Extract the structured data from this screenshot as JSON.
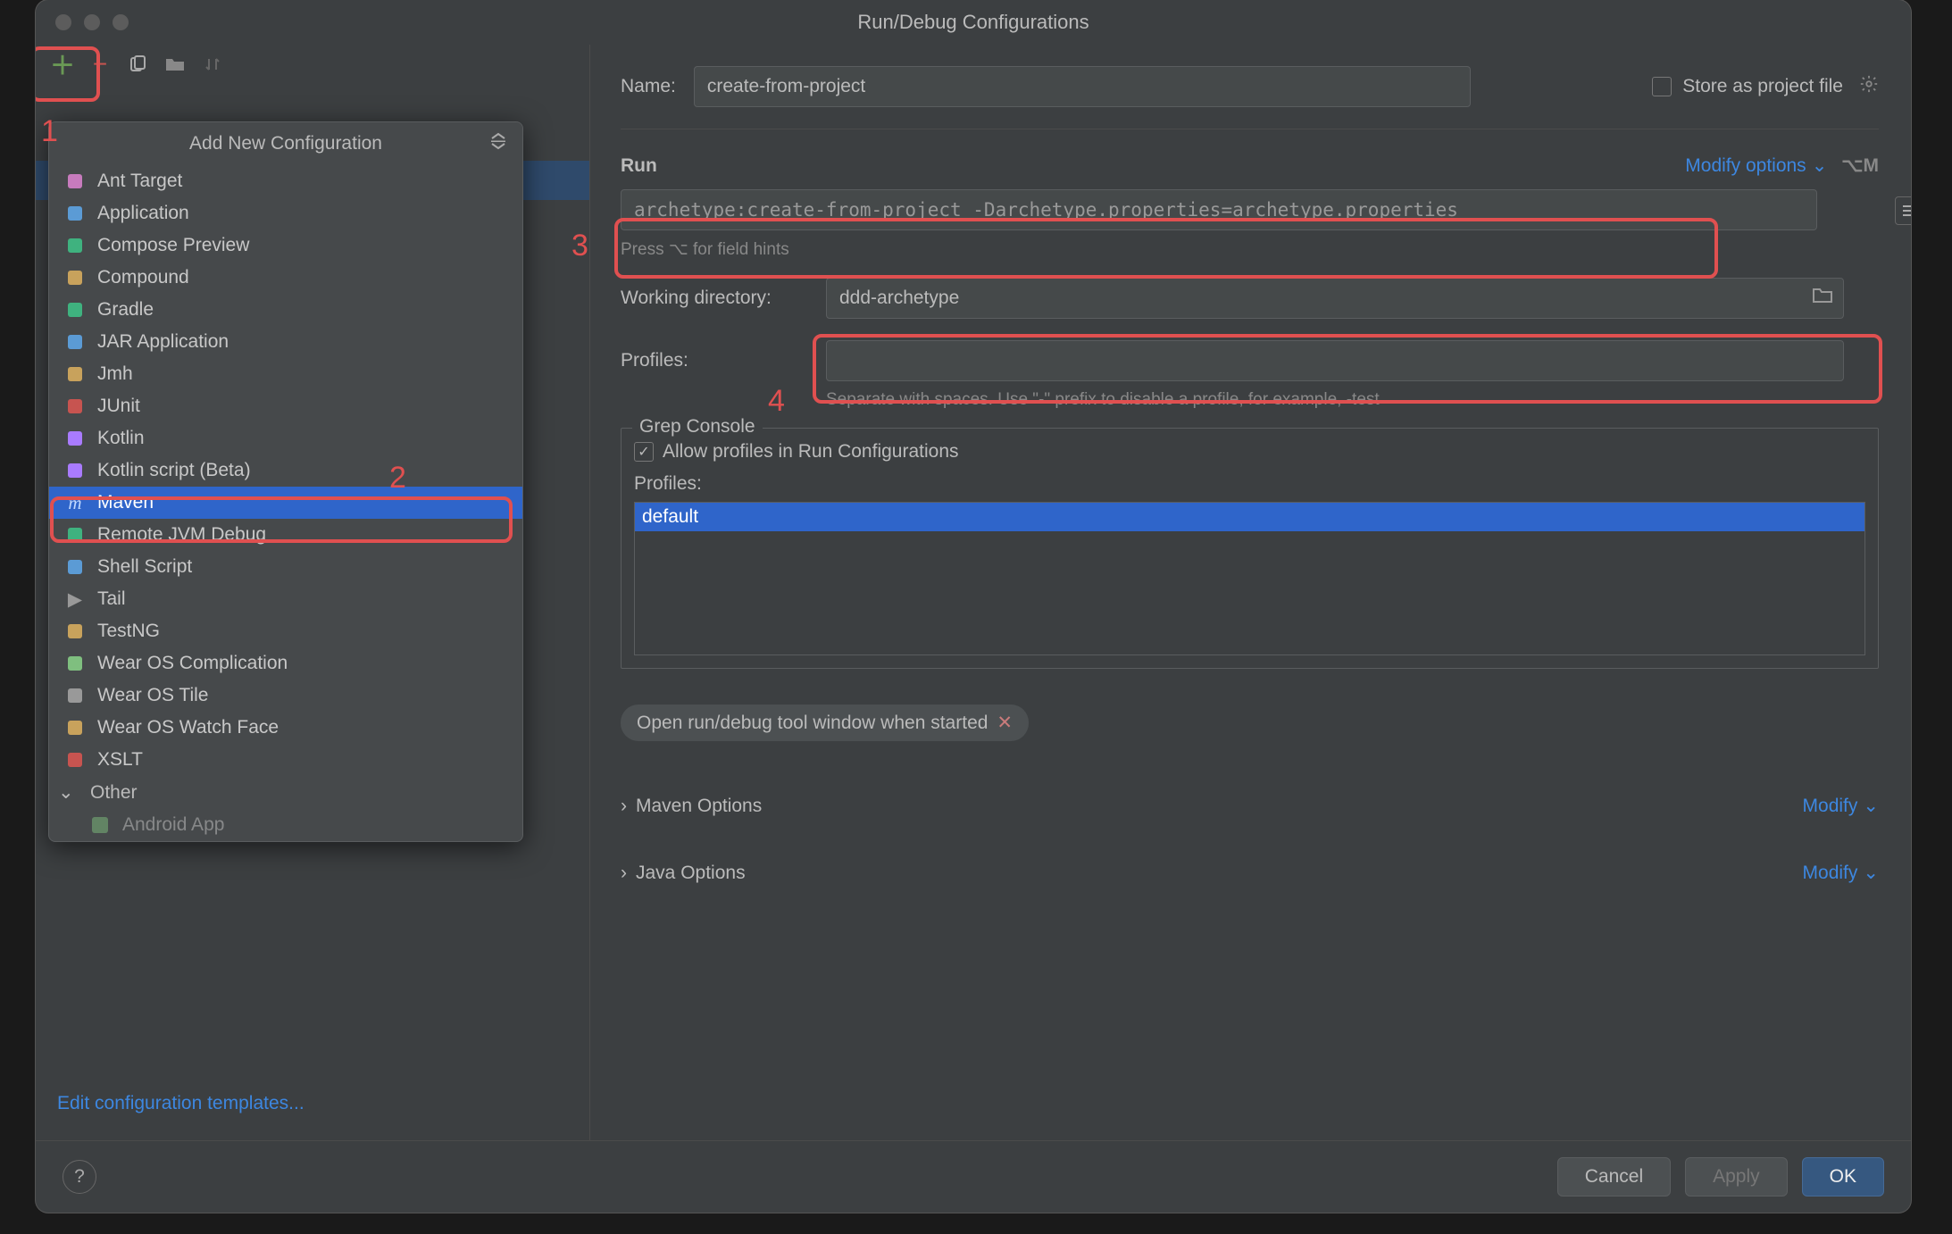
{
  "title": "Run/Debug Configurations",
  "toolbar": {
    "add_tooltip": "Add New Configuration",
    "remove_tooltip": "Remove Configuration",
    "copy_tooltip": "Copy Configuration",
    "folder_tooltip": "Create Folder",
    "sort_tooltip": "Sort"
  },
  "popup": {
    "title": "Add New Configuration",
    "items": [
      {
        "icon": "ant-icon",
        "label": "Ant Target",
        "color": "#c77bbd"
      },
      {
        "icon": "application-icon",
        "label": "Application",
        "color": "#5b9bd5"
      },
      {
        "icon": "compose-icon",
        "label": "Compose Preview",
        "color": "#3fb27f"
      },
      {
        "icon": "compound-icon",
        "label": "Compound",
        "color": "#c8a25c"
      },
      {
        "icon": "gradle-icon",
        "label": "Gradle",
        "color": "#3fb27f"
      },
      {
        "icon": "jar-icon",
        "label": "JAR Application",
        "color": "#5b9bd5"
      },
      {
        "icon": "jmh-icon",
        "label": "Jmh",
        "color": "#c8a25c"
      },
      {
        "icon": "junit-icon",
        "label": "JUnit",
        "color": "#c75450"
      },
      {
        "icon": "kotlin-icon",
        "label": "Kotlin",
        "color": "#a97bff"
      },
      {
        "icon": "kotlin-script-icon",
        "label": "Kotlin script (Beta)",
        "color": "#a97bff"
      },
      {
        "icon": "maven-icon",
        "label": "Maven",
        "color": "#4a86cf",
        "selected": true
      },
      {
        "icon": "remote-icon",
        "label": "Remote JVM Debug",
        "color": "#3fb27f"
      },
      {
        "icon": "shell-icon",
        "label": "Shell Script",
        "color": "#5b9bd5"
      },
      {
        "icon": "tail-icon",
        "label": "Tail",
        "color": "#999"
      },
      {
        "icon": "testng-icon",
        "label": "TestNG",
        "color": "#c8a25c"
      },
      {
        "icon": "wear-complication-icon",
        "label": "Wear OS Complication",
        "color": "#7fbf7f"
      },
      {
        "icon": "wear-tile-icon",
        "label": "Wear OS Tile",
        "color": "#999"
      },
      {
        "icon": "wear-watchface-icon",
        "label": "Wear OS Watch Face",
        "color": "#c8a25c"
      },
      {
        "icon": "xslt-icon",
        "label": "XSLT",
        "color": "#c75450"
      }
    ],
    "category": "Other",
    "hidden_item": "Android App"
  },
  "editTemplates": "Edit configuration templates...",
  "form": {
    "nameLabel": "Name:",
    "nameValue": "create-from-project",
    "storeLabel": "Store as project file",
    "runHeader": "Run",
    "modifyOptions": "Modify options",
    "modifyShortcut": "⌥M",
    "command": "archetype:create-from-project -Darchetype.properties=archetype.properties",
    "hint": "Press ⌥ for field hints",
    "wdLabel": "Working directory:",
    "wdValue": "ddd-archetype",
    "profilesLabel": "Profiles:",
    "profilesValue": "",
    "profilesHint": "Separate with spaces. Use \"-\" prefix to disable a profile, for example, -test",
    "grep": {
      "title": "Grep Console",
      "allowProfiles": "Allow profiles in Run Configurations",
      "profilesSubLabel": "Profiles:",
      "selected": "default"
    },
    "chipText": "Open run/debug tool window when started",
    "mavenOptions": "Maven Options",
    "javaOptions": "Java Options",
    "modify": "Modify"
  },
  "footer": {
    "cancel": "Cancel",
    "apply": "Apply",
    "ok": "OK"
  },
  "callouts": {
    "n1": "1",
    "n2": "2",
    "n3": "3",
    "n4": "4"
  }
}
